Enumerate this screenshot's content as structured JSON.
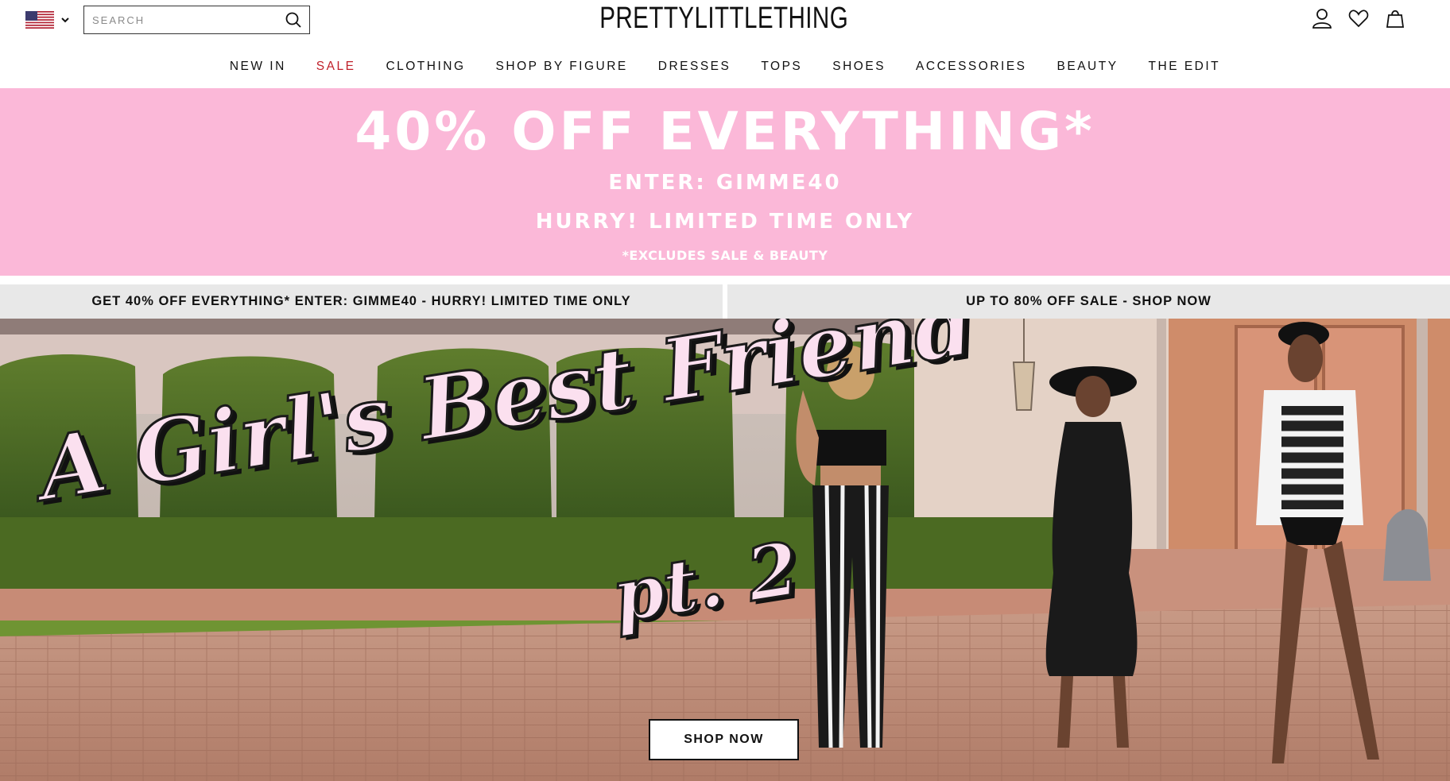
{
  "header": {
    "brand": "PRETTYLITTLETHING",
    "locale": {
      "country": "US",
      "icon": "us-flag-icon"
    },
    "search": {
      "placeholder": "SEARCH",
      "icon": "search-icon"
    },
    "icons": [
      "account-icon",
      "wishlist-heart-icon",
      "shopping-bag-icon"
    ]
  },
  "nav": {
    "items": [
      {
        "label": "NEW IN"
      },
      {
        "label": "SALE",
        "color": "#c0212b"
      },
      {
        "label": "CLOTHING"
      },
      {
        "label": "SHOP BY FIGURE"
      },
      {
        "label": "DRESSES"
      },
      {
        "label": "TOPS"
      },
      {
        "label": "SHOES"
      },
      {
        "label": "ACCESSORIES"
      },
      {
        "label": "BEAUTY"
      },
      {
        "label": "THE EDIT"
      }
    ]
  },
  "promo": {
    "background": "#fbb8d8",
    "headline": "40% OFF EVERYTHING*",
    "code_line": "ENTER: GIMME40",
    "urgency": "HURRY! LIMITED TIME ONLY",
    "exclusion": "*EXCLUDES SALE & BEAUTY"
  },
  "strips": {
    "left": "GET 40% OFF EVERYTHING* ENTER: GIMME40 - HURRY! LIMITED TIME ONLY",
    "right": "UP TO 80% OFF SALE - SHOP NOW"
  },
  "hero": {
    "title_line1": "A Girl's Best Friend",
    "title_line2": "pt. 2",
    "cta": "SHOP NOW"
  }
}
